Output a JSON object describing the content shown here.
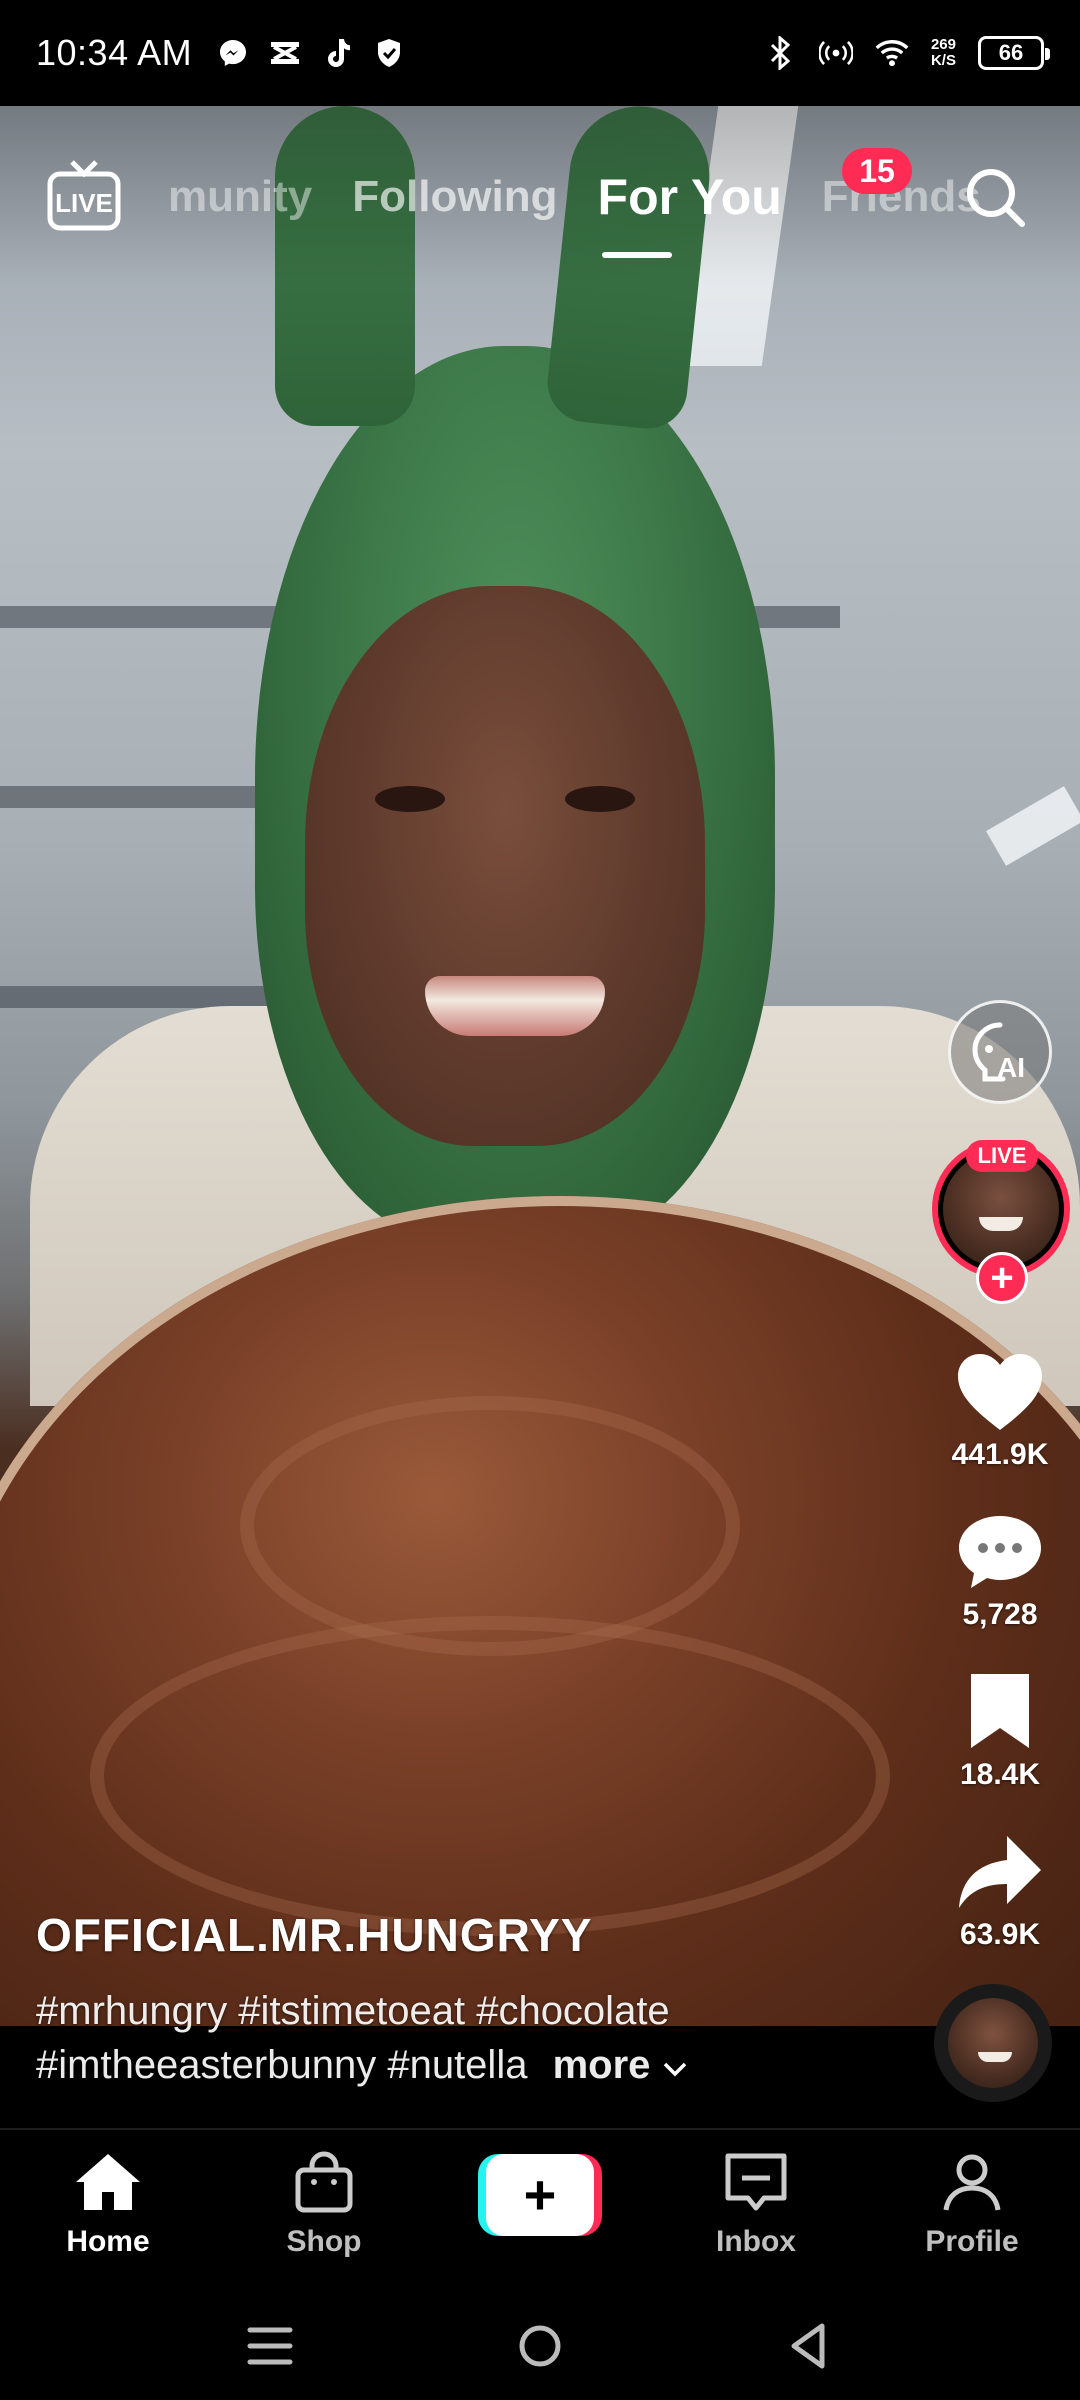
{
  "status_bar": {
    "time": "10:34 AM",
    "net_speed_value": "269",
    "net_speed_unit": "K/S",
    "battery": "66",
    "left_icons": [
      "messenger-icon",
      "capcut-icon",
      "tiktok-icon",
      "shield-icon"
    ],
    "right_icons": [
      "bluetooth-icon",
      "hotspot-icon",
      "wifi-icon"
    ]
  },
  "top_nav": {
    "tabs": [
      {
        "label": "munity",
        "state": "faded"
      },
      {
        "label": "Following",
        "state": "inactive"
      },
      {
        "label": "For You",
        "state": "active"
      },
      {
        "label": "Friends",
        "state": "faded"
      }
    ],
    "friends_badge": "15",
    "live_label": "LIVE"
  },
  "actions": {
    "ai_label": "AI",
    "live_pill": "LIVE",
    "likes": "441.9K",
    "comments": "5,728",
    "saves": "18.4K",
    "shares": "63.9K"
  },
  "caption": {
    "username": "OFFICIAL.MR.HUNGRYY",
    "hashtags_line1": "#mrhungry #itstimetoeat #chocolate",
    "hashtags_line2": "#imtheeasterbunny #nutella",
    "more_label": "more"
  },
  "bottom_nav": {
    "items": [
      {
        "label": "Home",
        "active": true
      },
      {
        "label": "Shop",
        "active": false
      },
      {
        "label": "Inbox",
        "active": false
      },
      {
        "label": "Profile",
        "active": false
      }
    ],
    "create_symbol": "+"
  },
  "colors": {
    "accent": "#fe2c55",
    "cyan": "#25f4ee",
    "background": "#000000",
    "text": "#ffffff"
  }
}
